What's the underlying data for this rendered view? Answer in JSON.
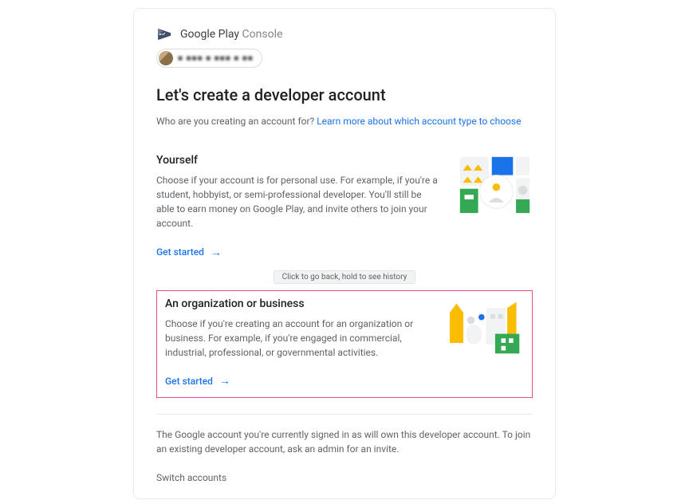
{
  "logo": {
    "brand": "Google Play",
    "product": "Console"
  },
  "user_chip": {
    "masked_text": "■  ■■■  ■  ■■■  ■    ■■"
  },
  "title": "Let's create a developer account",
  "subtitle": {
    "prefix": "Who are you creating an account for? ",
    "link": "Learn more about which account type to choose"
  },
  "options": {
    "yourself": {
      "title": "Yourself",
      "desc": "Choose if your account is for personal use. For example, if you're a student, hobbyist, or semi-professional developer. You'll still be able to earn money on Google Play, and invite others to join your account.",
      "cta": "Get started"
    },
    "org": {
      "title": "An organization or business",
      "desc": "Choose if you're creating an account for an organization or business. For example, if you're engaged in commercial, industrial, professional, or governmental activities.",
      "cta": "Get started"
    }
  },
  "tooltip": "Click to go back, hold to see history",
  "footer": "The Google account you're currently signed in as will own this developer account. To join an existing developer account, ask an admin for an invite.",
  "switch": "Switch accounts"
}
